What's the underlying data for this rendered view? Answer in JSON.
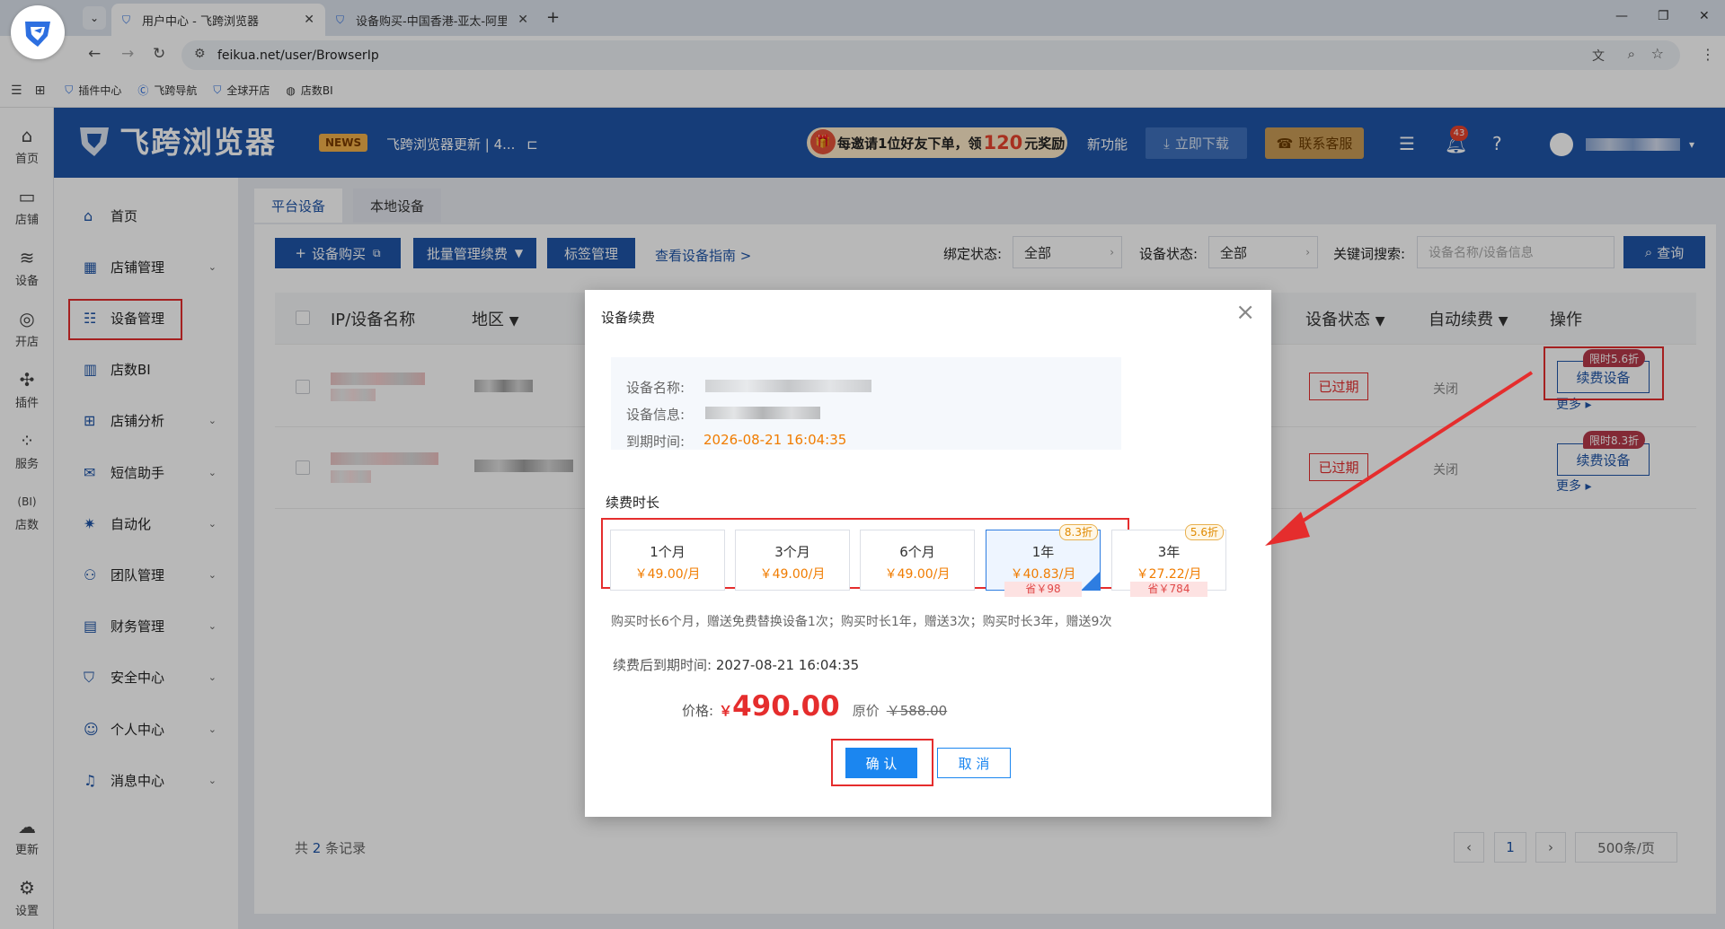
{
  "browser": {
    "tabs": [
      {
        "title": "用户中心 - 飞跨浏览器",
        "active": true
      },
      {
        "title": "设备购买-中国香港-亚太-阿里云",
        "active": false
      }
    ],
    "url": "feikua.net/user/BrowserIp",
    "bookmarks": [
      "插件中心",
      "飞跨导航",
      "全球开店",
      "店数BI"
    ]
  },
  "left_rail": [
    {
      "label": "首页",
      "icon": "home-icon"
    },
    {
      "label": "店铺",
      "icon": "store-icon"
    },
    {
      "label": "设备",
      "icon": "layers-icon"
    },
    {
      "label": "开店",
      "icon": "planet-icon"
    },
    {
      "label": "插件",
      "icon": "puzzle-icon"
    },
    {
      "label": "服务",
      "icon": "grid-icon"
    },
    {
      "label": "店数",
      "icon": "bi-icon"
    },
    {
      "label": "更新",
      "icon": "cloud-upload-icon"
    },
    {
      "label": "设置",
      "icon": "settings-icon"
    }
  ],
  "header": {
    "brand": "飞跨浏览器",
    "news_badge": "NEWS",
    "news_text": "飞跨浏览器更新 | 4...",
    "promo": {
      "pre": "每邀请1位好友下单，领",
      "amount": "120",
      "post": "元奖励"
    },
    "new_feature": "新功能",
    "download": "立即下载",
    "contact": "联系客服",
    "notify_count": "43"
  },
  "menu": [
    {
      "label": "首页",
      "icon": "home-icon",
      "chevron": false
    },
    {
      "label": "店铺管理",
      "icon": "shop-icon",
      "chevron": true
    },
    {
      "label": "设备管理",
      "icon": "device-icon",
      "chevron": false,
      "active": true
    },
    {
      "label": "店数BI",
      "icon": "bar-chart-icon",
      "chevron": false
    },
    {
      "label": "店铺分析",
      "icon": "analysis-icon",
      "chevron": true
    },
    {
      "label": "短信助手",
      "icon": "message-icon",
      "chevron": true
    },
    {
      "label": "自动化",
      "icon": "automation-icon",
      "chevron": true
    },
    {
      "label": "团队管理",
      "icon": "team-icon",
      "chevron": true
    },
    {
      "label": "财务管理",
      "icon": "wallet-icon",
      "chevron": true
    },
    {
      "label": "安全中心",
      "icon": "shield-icon",
      "chevron": true
    },
    {
      "label": "个人中心",
      "icon": "person-icon",
      "chevron": true
    },
    {
      "label": "消息中心",
      "icon": "bell-icon",
      "chevron": true
    }
  ],
  "content": {
    "tabs": [
      "平台设备",
      "本地设备"
    ],
    "buttons": {
      "buy": "设备购买",
      "batch": "批量管理续费",
      "tags": "标签管理",
      "guide": "查看设备指南 >",
      "query": "查询"
    },
    "filters": {
      "bind_label": "绑定状态:",
      "bind_value": "全部",
      "status_label": "设备状态:",
      "status_value": "全部",
      "keyword_label": "关键词搜索:",
      "keyword_placeholder": "设备名称/设备信息"
    },
    "columns": [
      "IP/设备名称",
      "地区",
      "设备状态",
      "自动续费",
      "操作"
    ],
    "rows": [
      {
        "status": "已过期",
        "auto_renew": "关闭",
        "action": "续费设备",
        "discount": "限时5.6折",
        "more": "更多"
      },
      {
        "status": "已过期",
        "auto_renew": "关闭",
        "action": "续费设备",
        "discount": "限时8.3折",
        "more": "更多"
      }
    ],
    "total": {
      "pre": "共",
      "count": "2",
      "post": "条记录"
    },
    "pager": {
      "page": "1",
      "size": "500条/页"
    }
  },
  "modal": {
    "title": "设备续费",
    "info": {
      "name_label": "设备名称:",
      "info_label": "设备信息:",
      "expire_label": "到期时间:",
      "expire_value": "2026-08-21 16:04:35"
    },
    "duration_label": "续费时长",
    "options": [
      {
        "name": "1个月",
        "price": "￥49.00/月"
      },
      {
        "name": "3个月",
        "price": "￥49.00/月"
      },
      {
        "name": "6个月",
        "price": "￥49.00/月"
      },
      {
        "name": "1年",
        "price": "￥40.83/月",
        "discount": "8.3折",
        "save": "省￥98",
        "selected": true
      },
      {
        "name": "3年",
        "price": "￥27.22/月",
        "discount": "5.6折",
        "save": "省￥784"
      }
    ],
    "note": "购买时长6个月，赠送免费替换设备1次；购买时长1年，赠送3次；购买时长3年，赠送9次",
    "new_expire_label": "续费后到期时间:",
    "new_expire_value": "2027-08-21 16:04:35",
    "price_label": "价格:",
    "currency": "￥",
    "price": "490.00",
    "orig_label": "原价",
    "orig_price": "￥588.00",
    "confirm": "确 认",
    "cancel": "取 消"
  },
  "colors": {
    "brand": "#1f55a8",
    "highlight": "#e52d2d",
    "price": "#e52d2d",
    "accent": "#f07c00"
  }
}
